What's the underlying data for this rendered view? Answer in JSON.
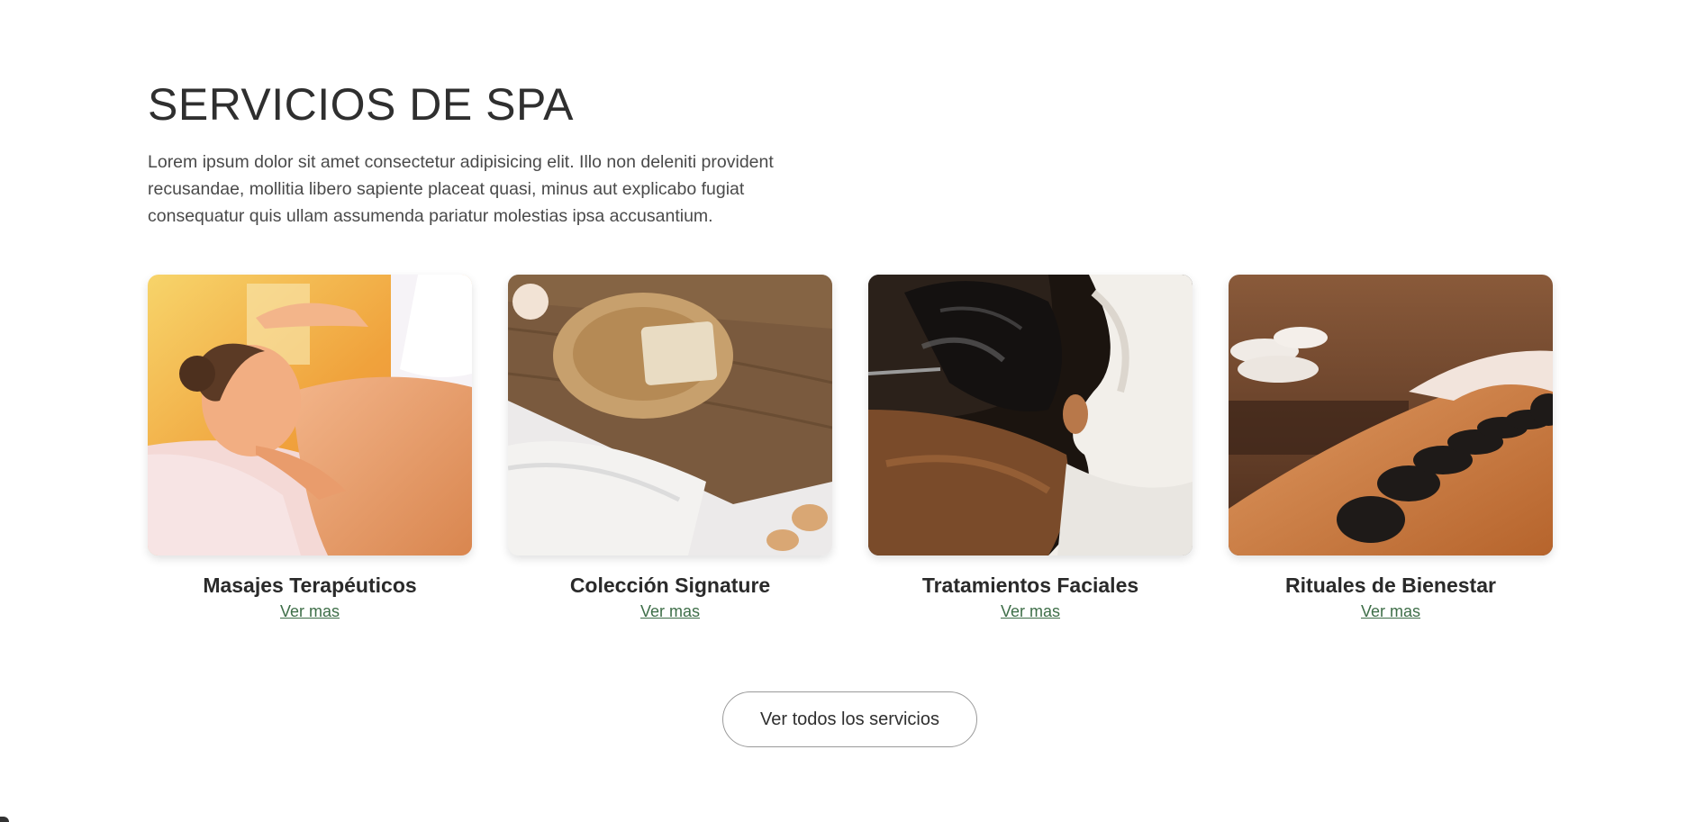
{
  "section": {
    "title": "SERVICIOS DE SPA",
    "intro": "Lorem ipsum dolor sit amet consectetur adipisicing elit. Illo non deleniti provident recusandae, mollitia libero sapiente placeat quasi, minus aut explicabo fugiat consequatur quis ullam assumenda pariatur molestias ipsa accusantium."
  },
  "cards": [
    {
      "title": "Masajes Terapéuticos",
      "link": "Ver mas"
    },
    {
      "title": "Colección Signature",
      "link": "Ver mas"
    },
    {
      "title": "Tratamientos Faciales",
      "link": "Ver mas"
    },
    {
      "title": "Rituales de Bienestar",
      "link": "Ver mas"
    }
  ],
  "all_services_button": "Ver todos los servicios",
  "colors": {
    "link": "#3e6e48",
    "title": "#2f2f2f",
    "body_text": "#4a4a4a",
    "button_border": "#9a9a9a"
  }
}
